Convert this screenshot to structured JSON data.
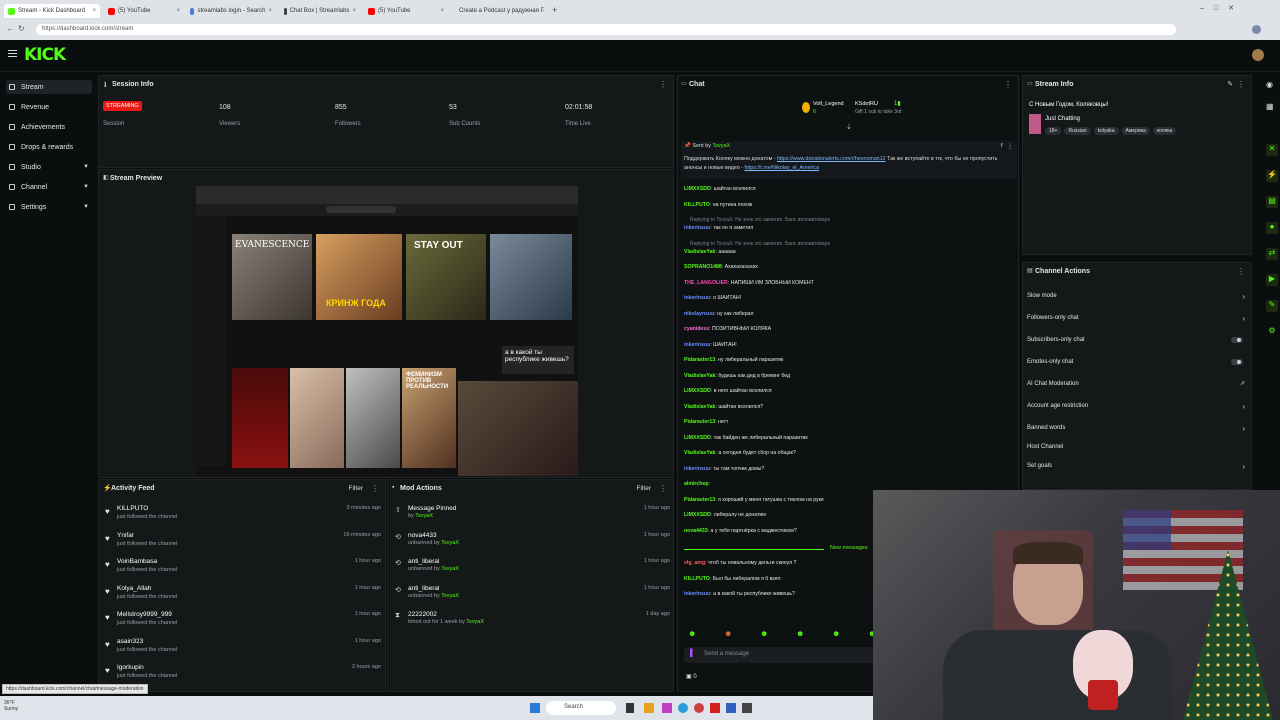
{
  "browser": {
    "tabs": [
      {
        "label": "Stream - Kick Dashboard",
        "fav": "#53fc18"
      },
      {
        "label": "(5) YouTube",
        "fav": "#ff0000"
      },
      {
        "label": "streamlabs login - Search",
        "fav": "#4a7bd8"
      },
      {
        "label": "Chat Box | Streamlabs",
        "fav": "#444"
      },
      {
        "label": "(5) YouTube",
        "fav": "#ff0000"
      },
      {
        "label": "Create a Podcast у радужная Го",
        "fav": "#555"
      }
    ],
    "url": "https://dashboard.kick.com/stream"
  },
  "brand": {
    "logo": "KICK",
    "accent": "#53fc18"
  },
  "sidebar": {
    "items": [
      {
        "label": "Stream"
      },
      {
        "label": "Revenue"
      },
      {
        "label": "Achievements"
      },
      {
        "label": "Drops & rewards"
      },
      {
        "label": "Studio"
      },
      {
        "label": "Channel"
      },
      {
        "label": "Settings"
      }
    ]
  },
  "session": {
    "title": "Session Info",
    "status": "STREAMING",
    "status_label": "Session",
    "stats": [
      {
        "value": "108",
        "label": "Viewers"
      },
      {
        "value": "855",
        "label": "Followers"
      },
      {
        "value": "53",
        "label": "Sub Counts"
      },
      {
        "value": "02:01:58",
        "label": "Time Live"
      }
    ]
  },
  "preview": {
    "title": "Stream Preview",
    "overlay_text": "а в какой ты республике живешь?",
    "thumbs": [
      "EVANESCENCE",
      "КРИНЖ ГОДА",
      "STAY OUT",
      "ФЕМИНИЗМ ПРОТИВ РЕАЛЬНОСТИ"
    ]
  },
  "activity": {
    "title": "Activity Feed",
    "filter": "Filter",
    "items": [
      {
        "name": "KILLPUTO",
        "sub": "just followed the channel",
        "time": "3 minutes ago"
      },
      {
        "name": "Ynifar",
        "sub": "just followed the channel",
        "time": "16 minutes ago"
      },
      {
        "name": "VoinBambasa",
        "sub": "just followed the channel",
        "time": "1 hour ago"
      },
      {
        "name": "Kolya_Allah",
        "sub": "just followed the channel",
        "time": "1 hour ago"
      },
      {
        "name": "Mellstroy9999_999",
        "sub": "just followed the channel",
        "time": "1 hour ago"
      },
      {
        "name": "asain323",
        "sub": "just followed the channel",
        "time": "1 hour ago"
      },
      {
        "name": "Igorkupin",
        "sub": "just followed the channel",
        "time": "2 hours ago"
      }
    ]
  },
  "mod": {
    "title": "Mod Actions",
    "filter": "Filter",
    "items": [
      {
        "name": "Message Pinned",
        "pre": "by ",
        "user": "TsvyaX",
        "post": "",
        "time": "1 hour ago",
        "icon": "pin-icon",
        "glyph": "⇧"
      },
      {
        "name": "nova4433",
        "pre": "unbanned by ",
        "user": "TsvyaX",
        "post": "",
        "time": "1 hour ago",
        "icon": "unban-icon",
        "glyph": "⟲"
      },
      {
        "name": "anti_liberal",
        "pre": "unbanned by ",
        "user": "TsvyaX",
        "post": "",
        "time": "1 hour ago",
        "icon": "unban-icon",
        "glyph": "⟲"
      },
      {
        "name": "anti_liberal",
        "pre": "unbanned by ",
        "user": "TsvyaX",
        "post": "",
        "time": "1 hour ago",
        "icon": "unban-icon",
        "glyph": "⟲"
      },
      {
        "name": "22222002",
        "pre": "timed out for 1 week by ",
        "user": "TsvyaX",
        "post": "",
        "time": "1 day ago",
        "icon": "hourglass-icon",
        "glyph": "⧗"
      }
    ]
  },
  "chat": {
    "title": "Chat",
    "top_user1": "Volt_Legend",
    "top_user2": "KSdotRU",
    "top_sub1": "6",
    "top_sub2": "Gift 1 sub to take 3rd",
    "pinned_by": "Sent by",
    "pinned_user": "TsvyaX",
    "pinned_text": "Поддержать Коляку можно донатом - ",
    "pinned_link1": "https://www.donationalerts.com/r/hexnoman12",
    "pinned_mid": " Так же вступайте в тгк, что бы не пропустить анонсы и новые видео - ",
    "pinned_link2": "https://t.me/Nikolay_el_America",
    "messages": [
      {
        "u": "LIMXXSDD",
        "c": "#53fc18",
        "t": "шайтан вселился"
      },
      {
        "u": "KILLPUTO",
        "c": "#53fc18",
        "t": "на путина похож"
      },
      {
        "reply": "Replying to TsvyaX: Не зонк это заметил. Банс велоавтовера"
      },
      {
        "u": "inkerinsuu",
        "c": "#6b8cff",
        "t": "так он я заметил"
      },
      {
        "reply": "Replying to TsvyaX: Не зонк это заметил. Банс велоавтовера"
      },
      {
        "u": "VladislavYak",
        "c": "#53fc18",
        "t": "аааааа"
      },
      {
        "u": "SOPRANO1488",
        "c": "#53fc18",
        "t": "Ахахахахахах"
      },
      {
        "u": "THE_LANGOLIER",
        "c": "#ff4bb4",
        "t": "НАПИШИ ИМ ЗЛОБНЫЙ КОМЕНТ"
      },
      {
        "u": "inkerinsuu",
        "c": "#6b8cff",
        "t": "о ШАЙТАН!"
      },
      {
        "u": "nikolaynsuu",
        "c": "#6b8cff",
        "t": "ну как либерал"
      },
      {
        "u": "cyanidess",
        "c": "#ff6bd0",
        "t": "ПОЗИТИВНЫЙ КОЛЯКА"
      },
      {
        "u": "inkerinsuu",
        "c": "#6b8cff",
        "t": "ШАЙТАН!"
      },
      {
        "u": "Pidaraster13",
        "c": "#53fc18",
        "t": "ну либеральный паразитик"
      },
      {
        "u": "VladislavYak",
        "c": "#53fc18",
        "t": "будешь как дед в брекинг бед"
      },
      {
        "u": "LIMXXSDD",
        "c": "#53fc18",
        "t": "в него шайтан вселился"
      },
      {
        "u": "VladislavYak",
        "c": "#53fc18",
        "t": "шайтан вселился?"
      },
      {
        "u": "Pidaraster13",
        "c": "#53fc18",
        "t": "нетт"
      },
      {
        "u": "LIMXXSDD",
        "c": "#53fc18",
        "t": "так байден же либеральный паразитик"
      },
      {
        "u": "VladislavYak",
        "c": "#53fc18",
        "t": "а сегодня будет сбор на общак?"
      },
      {
        "u": "inkerinsuu",
        "c": "#6b8cff",
        "t": "ты там топчик домы?"
      },
      {
        "u": "almirchep",
        "c": "#53fc18",
        "t": ""
      },
      {
        "u": "Pidaraster13",
        "c": "#53fc18",
        "t": "я хороший у меня татушка с тиклом на руке"
      },
      {
        "u": "LIMXXSDD",
        "c": "#53fc18",
        "t": "либералу не донатим"
      },
      {
        "u": "nova4433",
        "c": "#53fc18",
        "t": "а у тебя партнёрка с маджестиком?"
      }
    ],
    "new_messages": "New messages",
    "after": [
      {
        "u": "vlg_amg",
        "c": "#ff5a5a",
        "t": "чтоб ты новальному деньги скинул ?"
      },
      {
        "u": "KILLPUTO",
        "c": "#53fc18",
        "t": "Был бы либералом я б взял"
      },
      {
        "u": "inkerinsuu",
        "c": "#6b8cff",
        "t": "а в какой ты республике живешь?"
      }
    ],
    "input_placeholder": "Send a message",
    "count": "0"
  },
  "stream_info": {
    "title": "Stream Info",
    "stream_title": "С Новым Годом, Коляковцы!",
    "category": "Just Chatting",
    "tags": [
      "18+",
      "Russian",
      "kolyaka",
      "Америка",
      "колякa"
    ]
  },
  "actions": {
    "title": "Channel Actions",
    "items": [
      {
        "label": "Slow mode",
        "ctrl": "chev"
      },
      {
        "label": "Followers-only chat",
        "ctrl": "chev"
      },
      {
        "label": "Subscribers-only chat",
        "ctrl": "toggle"
      },
      {
        "label": "Emotes-only chat",
        "ctrl": "toggle"
      },
      {
        "label": "AI Chat Moderation",
        "ctrl": "ext"
      },
      {
        "label": "Account age restriction",
        "ctrl": "chev"
      },
      {
        "label": "Banned words",
        "ctrl": "chev"
      },
      {
        "label": "Host Channel",
        "ctrl": "none"
      },
      {
        "label": "Set goals",
        "ctrl": "chev"
      }
    ]
  },
  "status_bar": {
    "url": "https://dashboard.kick.com/channel/chat/message-moderation"
  },
  "taskbar": {
    "search": "Search",
    "weather": "36°F",
    "weather_sub": "Sunny"
  },
  "colors": {
    "bg": "#0b0e0f",
    "panel": "#151819",
    "accent": "#53fc18",
    "live": "#e91916"
  }
}
